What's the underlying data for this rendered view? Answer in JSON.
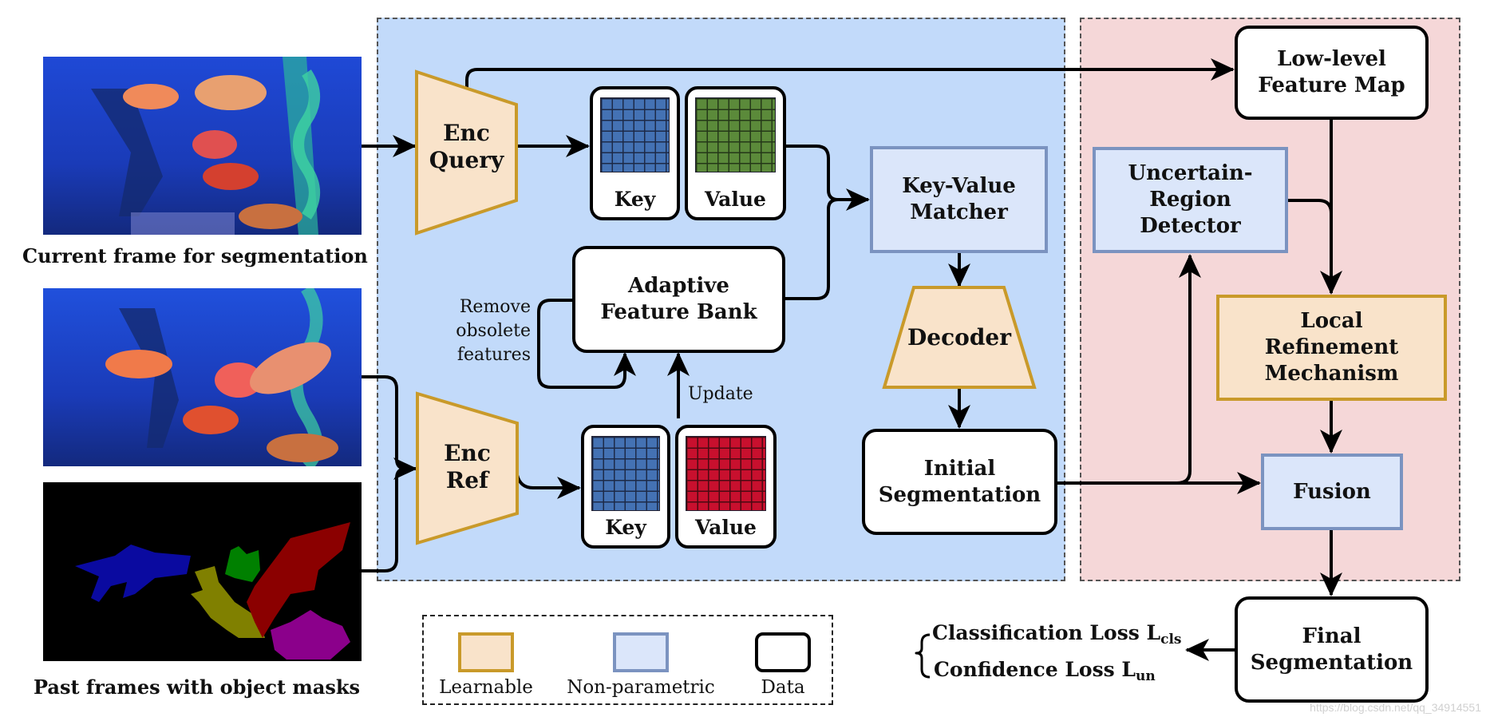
{
  "colors": {
    "learnable_fill": "#f9e3ca",
    "learnable_border": "#c99a2a",
    "nonparam_fill": "#dbe6fa",
    "nonparam_border": "#7b93c0",
    "data_fill": "#ffffff",
    "data_border": "#000000",
    "panel_blue": "#c2dafa",
    "panel_pink": "#f5d7d8",
    "key_grid": "#4472b4",
    "value_grid_query": "#5b8a3a",
    "value_grid_ref": "#c8102e"
  },
  "inputs": {
    "current_frame_caption": "Current frame for segmentation",
    "past_frames_caption": "Past frames with object masks",
    "mask_colors": [
      "#0a0aa0",
      "#808000",
      "#008000",
      "#8b0000",
      "#8b008b"
    ]
  },
  "encoders": {
    "query": [
      "Enc",
      "Query"
    ],
    "ref": [
      "Enc",
      "Ref"
    ]
  },
  "features": {
    "key_label": "Key",
    "value_label": "Value"
  },
  "adaptive_bank": [
    "Adaptive",
    "Feature Bank"
  ],
  "notes": {
    "remove": [
      "Remove",
      "obsolete",
      "features"
    ],
    "update": "Update"
  },
  "matcher": [
    "Key-Value",
    "Matcher"
  ],
  "decoder": "Decoder",
  "initial_seg": [
    "Initial",
    "Segmentation"
  ],
  "low_level": [
    "Low-level",
    "Feature Map"
  ],
  "uncertain": [
    "Uncertain-",
    "Region",
    "Detector"
  ],
  "local_refinement": [
    "Local",
    "Refinement",
    "Mechanism"
  ],
  "fusion": "Fusion",
  "final_seg": [
    "Final",
    "Segmentation"
  ],
  "losses": {
    "cls": {
      "text": "Classification Loss L",
      "sub": "cls"
    },
    "un": {
      "text": "Confidence Loss L",
      "sub": "un"
    }
  },
  "legend": {
    "learnable": "Learnable",
    "nonparam": "Non-parametric",
    "data": "Data"
  },
  "watermark": "https://blog.csdn.net/qq_34914551"
}
